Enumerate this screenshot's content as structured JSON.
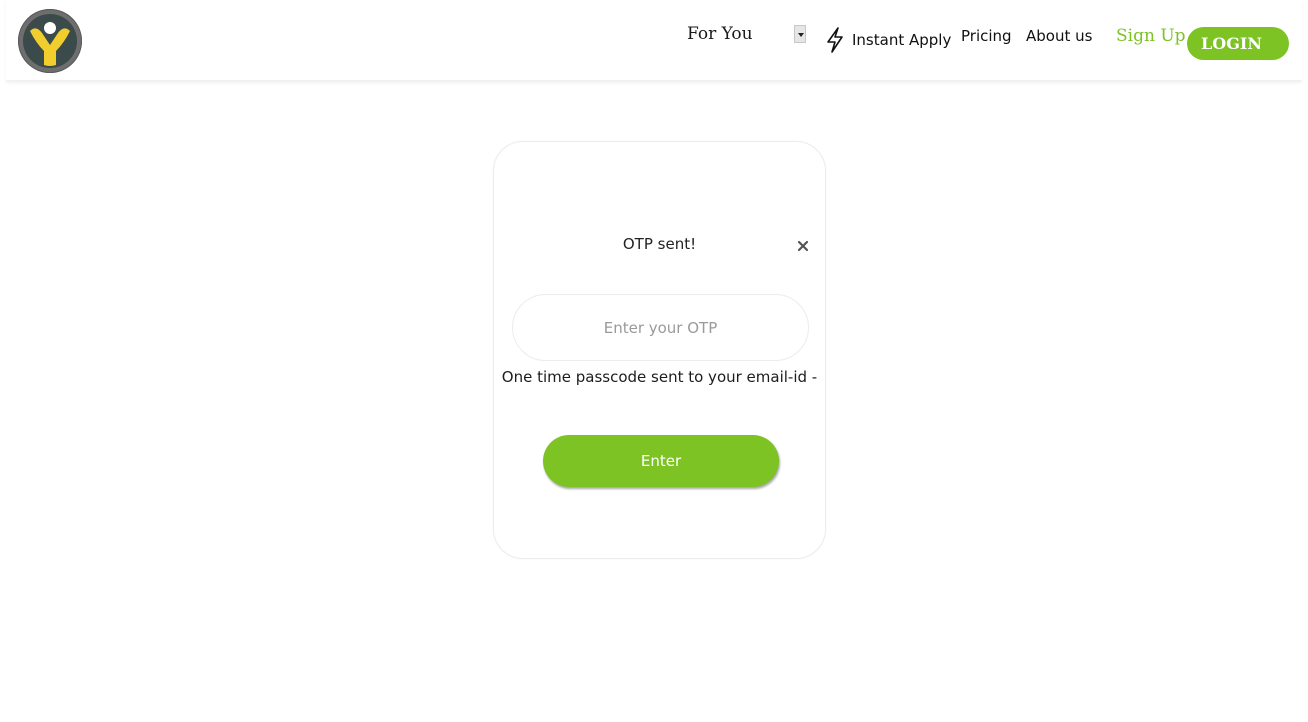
{
  "header": {
    "nav": {
      "for_you": "For You",
      "instant_apply": "Instant Apply",
      "pricing": "Pricing",
      "about": "About us",
      "signup": "Sign Up",
      "login": "LOGIN"
    },
    "icons": {
      "logo": "person-logo-icon",
      "dropdown": "dropdown-arrow-icon",
      "instant": "lightning-bolt-icon"
    }
  },
  "otp_card": {
    "title": "OTP sent!",
    "close_icon": "close-icon",
    "input_value": "",
    "input_placeholder": "Enter your OTP",
    "hint": "One time passcode sent to your email-id -",
    "button_label": "Enter"
  },
  "colors": {
    "accent_green": "#7cc323",
    "logo_gray": "#6e6e6e",
    "logo_yellow": "#f2cd2e",
    "logo_dark": "#3b4a4a"
  }
}
